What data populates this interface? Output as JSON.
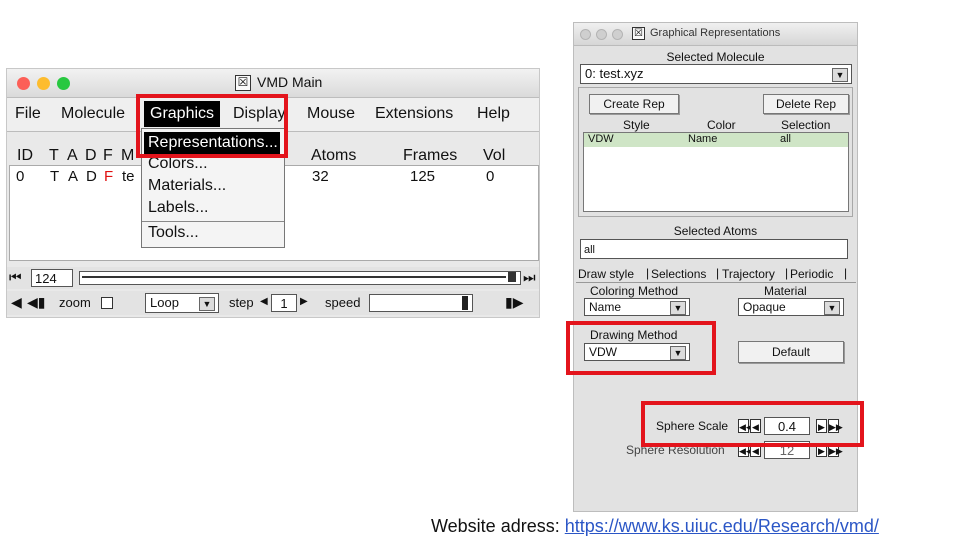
{
  "vmd_main": {
    "title": "VMD Main",
    "menus": [
      "File",
      "Molecule",
      "Graphics",
      "Display",
      "Mouse",
      "Extensions",
      "Help"
    ],
    "columns": {
      "id": "ID",
      "flags": [
        "T",
        "A",
        "D",
        "F",
        "M"
      ],
      "atoms": "Atoms",
      "frames": "Frames",
      "vol": "Vol"
    },
    "row": {
      "id": "0",
      "flags": [
        "T",
        "A",
        "D",
        "F"
      ],
      "name": "te",
      "atoms": "32",
      "frames": "125",
      "vol": "0"
    },
    "frame_value": "124",
    "zoom_label": "zoom",
    "loop_value": "Loop",
    "step_label": "step",
    "step_value": "1",
    "speed_label": "speed",
    "graphics_menu": [
      "Representations...",
      "Colors...",
      "Materials...",
      "Labels...",
      "Tools..."
    ]
  },
  "rep_window": {
    "title": "Graphical Representations",
    "selected_molecule_label": "Selected Molecule",
    "molecule_value": "0: test.xyz",
    "create_rep": "Create Rep",
    "delete_rep": "Delete Rep",
    "rep_columns": [
      "Style",
      "Color",
      "Selection"
    ],
    "rep_row": [
      "VDW",
      "Name",
      "all"
    ],
    "selected_atoms_label": "Selected Atoms",
    "selected_atoms_value": "all",
    "tabs": [
      "Draw style",
      "Selections",
      "Trajectory",
      "Periodic"
    ],
    "coloring_method_label": "Coloring Method",
    "coloring_method_value": "Name",
    "material_label": "Material",
    "material_value": "Opaque",
    "drawing_method_label": "Drawing Method",
    "drawing_method_value": "VDW",
    "default_button": "Default",
    "sphere_scale_label": "Sphere Scale",
    "sphere_scale_value": "0.4",
    "sphere_resolution_label": "Sphere Resolution",
    "sphere_resolution_value": "12"
  },
  "caption": {
    "prefix": "Website adress: ",
    "url": "https://www.ks.uiuc.edu/Research/vmd/"
  },
  "colors": {
    "highlight": "#e3141c",
    "link": "#2b56c6",
    "flag_red": "#e01010",
    "selected_row": "#cfe5c6"
  }
}
